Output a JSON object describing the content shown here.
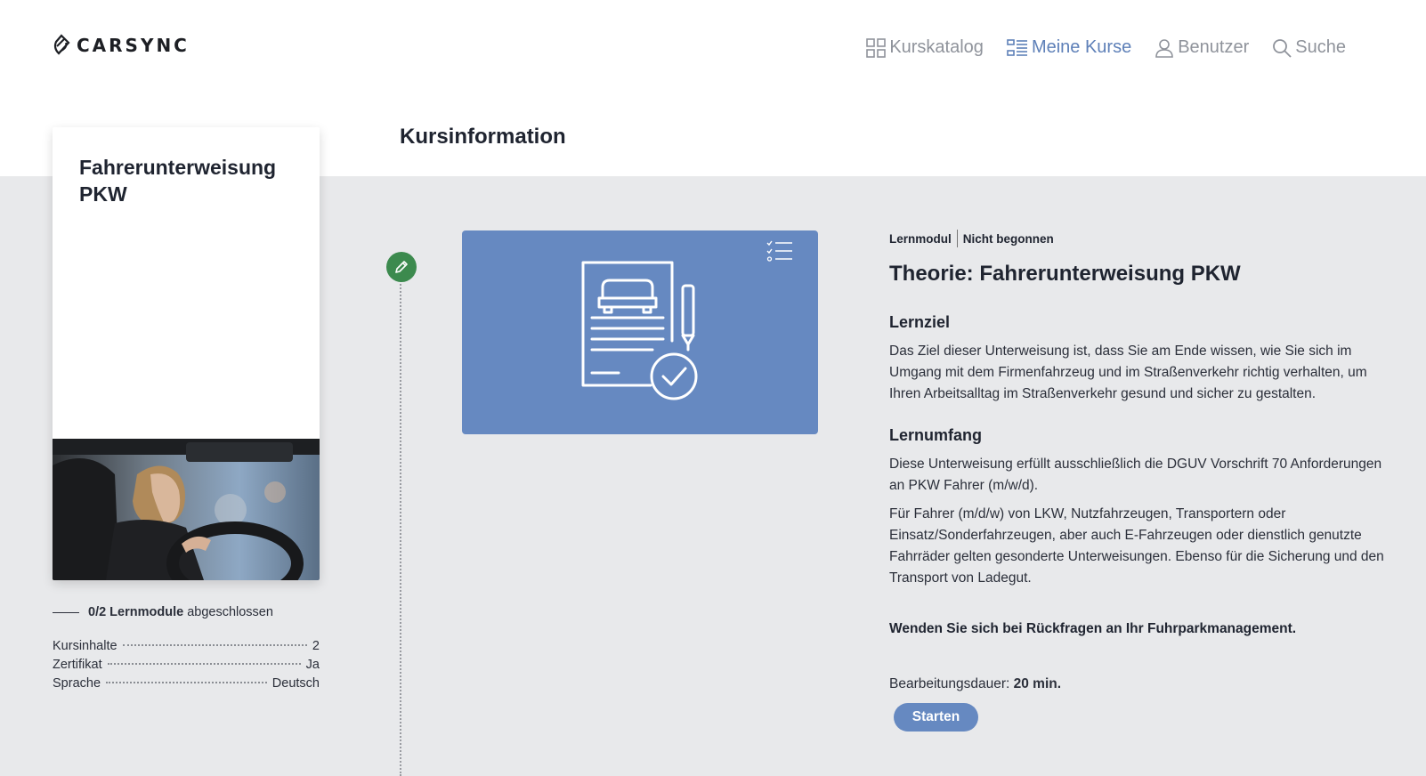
{
  "brand": {
    "name": "CARSYNC"
  },
  "nav": {
    "items": [
      {
        "label": "Kurskatalog",
        "icon": "grid-icon",
        "active": false
      },
      {
        "label": "Meine Kurse",
        "icon": "list-icon",
        "active": true
      },
      {
        "label": "Benutzer",
        "icon": "user-icon",
        "active": false
      },
      {
        "label": "Suche",
        "icon": "search-icon",
        "active": false
      }
    ]
  },
  "page": {
    "section_title": "Kursinformation"
  },
  "course": {
    "title": "Fahrerunterweisung PKW",
    "progress": {
      "count": "0/2 Lernmodule",
      "suffix": "abgeschlossen"
    },
    "meta": [
      {
        "label": "Kursinhalte",
        "value": "2"
      },
      {
        "label": "Zertifikat",
        "value": "Ja"
      },
      {
        "label": "Sprache",
        "value": "Deutsch"
      }
    ]
  },
  "module": {
    "type": "Lernmodul",
    "status": "Nicht begonnen",
    "title": "Theorie: Fahrerunterweisung PKW",
    "goal_heading": "Lernziel",
    "goal_text": "Das Ziel dieser Unterweisung ist, dass Sie am Ende wissen, wie Sie sich im Umgang mit dem Firmenfahrzeug und im Straßenverkehr richtig verhalten, um Ihren Arbeitsalltag im Straßenverkehr gesund und sicher zu gestalten.",
    "scope_heading": "Lernumfang",
    "scope_text_1": "Diese Unterweisung erfüllt ausschließlich die DGUV Vorschrift 70 Anforderungen an PKW Fahrer (m/w/d).",
    "scope_text_2": "Für Fahrer (m/d/w) von LKW, Nutzfahrzeugen, Transportern oder Einsatz/Sonderfahrzeugen, aber auch E-Fahrzeugen oder dienstlich genutzte Fahrräder gelten gesonderte Unterweisungen. Ebenso für die Sicherung und den Transport von Ladegut.",
    "contact": "Wenden Sie sich bei Rückfragen an Ihr Fuhrparkmanagement.",
    "duration_label": "Bearbeitungsdauer:",
    "duration_value": "20 min.",
    "start_label": "Starten"
  },
  "colors": {
    "accent": "#6689c1",
    "active_nav": "#5e80b8",
    "done_green": "#3c8a4e",
    "background": "#e8e9eb"
  }
}
